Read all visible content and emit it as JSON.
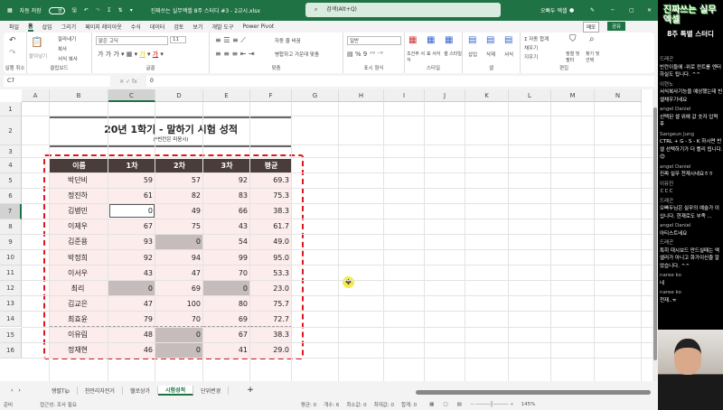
{
  "titlebar": {
    "autosave": "자동 저장",
    "autosave_state": "끔",
    "filename": "진짜쓰는 실무엑셀 8주 스터디 #3 - 2교시.xlsx",
    "search_placeholder": "검색(Alt+Q)",
    "user": "오빠두 엑셀"
  },
  "menu": [
    "파일",
    "홈",
    "삽입",
    "그리기",
    "페이지 레이아웃",
    "수식",
    "데이터",
    "검토",
    "보기",
    "개발 도구",
    "Power Pivot"
  ],
  "menu_active": "홈",
  "memo": "메모",
  "share": "공유",
  "ribbon": {
    "undo_group": "실행 취소",
    "paste": "붙여넣기",
    "cut": "잘라내기",
    "copy": "복사",
    "format_painter": "서식 복사",
    "clipboard": "클립보드",
    "font_name": "맑은 고딕",
    "font_size": "11",
    "font_group": "글꼴",
    "wrap": "자동 줄 바꿈",
    "merge": "병합하고 가운데 맞춤",
    "align_group": "맞춤",
    "number_format": "일반",
    "number_group": "표시 형식",
    "cond_format": "조건부 서식",
    "table_format": "표 서식",
    "cell_style": "셀 스타일",
    "style_group": "스타일",
    "insert": "삽입",
    "delete": "삭제",
    "format": "서식",
    "cells_group": "셀",
    "autosum": "자동 합계",
    "fill": "채우기",
    "clear": "지우기",
    "sort": "정렬 및 필터",
    "find": "찾기 및 선택",
    "edit_group": "편집"
  },
  "formula": {
    "namebox": "C7",
    "value": "0"
  },
  "columns": [
    "A",
    "B",
    "C",
    "D",
    "E",
    "F",
    "G",
    "H",
    "I",
    "J",
    "K",
    "L",
    "M",
    "N"
  ],
  "rows": [
    "1",
    "2",
    "3",
    "4",
    "5",
    "6",
    "7",
    "8",
    "9",
    "10",
    "11",
    "12",
    "13",
    "14",
    "15",
    "16"
  ],
  "sheet": {
    "title": "20년 1학기 - 말하기 시험 성적",
    "subtitle": "(*빈칸은 미응시)",
    "headers": [
      "이름",
      "1차",
      "2차",
      "3차",
      "평균"
    ],
    "data": [
      [
        "박단비",
        "59",
        "57",
        "92",
        "69.3"
      ],
      [
        "정진하",
        "61",
        "82",
        "83",
        "75.3"
      ],
      [
        "김병민",
        "0",
        "49",
        "66",
        "38.3"
      ],
      [
        "이제우",
        "67",
        "75",
        "43",
        "61.7"
      ],
      [
        "김준용",
        "93",
        "0",
        "54",
        "49.0"
      ],
      [
        "박정희",
        "92",
        "94",
        "99",
        "95.0"
      ],
      [
        "이서우",
        "43",
        "47",
        "70",
        "53.3"
      ],
      [
        "최리",
        "0",
        "69",
        "0",
        "23.0"
      ],
      [
        "김교은",
        "47",
        "100",
        "80",
        "75.7"
      ],
      [
        "최효윤",
        "79",
        "70",
        "69",
        "72.7"
      ],
      [
        "이유림",
        "48",
        "0",
        "67",
        "38.3"
      ],
      [
        "정재현",
        "46",
        "0",
        "41",
        "29.0"
      ]
    ]
  },
  "tabs": [
    "쟁렬Tip",
    "천만리자전거",
    "헬로상가",
    "시험성적",
    "단위변경"
  ],
  "active_tab": "시험성적",
  "status": {
    "ready": "준비",
    "accessibility": "접근성: 조사 필요",
    "average": "평균: 0",
    "count": "개수: 6",
    "min": "최소값: 0",
    "max": "최대값: 0",
    "sum": "합계: 0",
    "zoom": "145%"
  },
  "stream": {
    "logo": "진짜쓰는 실무엑셀",
    "title": "8주 특별 스터디",
    "chat": [
      {
        "author": "드래곤",
        "text": "빈칸이들에 -위로 컨트롤 엔터 하실도 됩니다. ^^"
      },
      {
        "author": "이현노",
        "text": "서식복사기능을 예상했는데 빈셀채우기네요"
      },
      {
        "author": "angel Daniel",
        "text": "선택된 셀 위에 값 숫자 입력 후"
      },
      {
        "author": "Sangeun Jung",
        "text": "CTRL + G - S - K 하시면 빈 셀 선택하기가 더 빨리 됩니다. 😊"
      },
      {
        "author": "angel Daniel",
        "text": "진짜 실무 천재시네요ㅎㅎ"
      },
      {
        "author": "이유진",
        "text": "ㄷㄷㄷ"
      },
      {
        "author": "드래곤",
        "text": "오빠두님은 실무의 예술가 이십니다. 현재로도 부족 ..."
      },
      {
        "author": "angel Daniel",
        "text": "아티스트네요"
      },
      {
        "author": "드래곤",
        "text": "특히 대시보드 만드실때는 엑셀러가 아니고 화가이신줄 알았습니다. ^^"
      },
      {
        "author": "naree ko",
        "text": "네"
      },
      {
        "author": "naree ko",
        "text": "천재..ㅠ"
      }
    ]
  },
  "colors": {
    "excel_green": "#1f7244",
    "header_fill": "#4a3c3a",
    "row_fill": "#fcecec",
    "blank_fill": "#c7bcbc",
    "highlight_border": "#e0141e"
  }
}
